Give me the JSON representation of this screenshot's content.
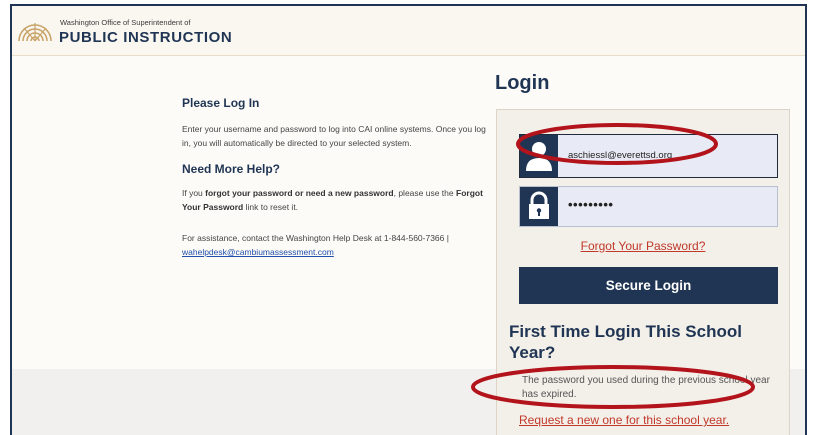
{
  "header": {
    "org_line": "Washington Office of Superintendent of",
    "org_name": "PUBLIC INSTRUCTION"
  },
  "info": {
    "heading": "Please Log In",
    "intro": "Enter your username and password to log into CAI online systems. Once you log in, you will automatically be directed to your selected system.",
    "help_heading": "Need More Help?",
    "help_pre": "If you ",
    "help_bold1": "forgot your password or need a new password",
    "help_mid": ", please use the ",
    "help_bold2": "Forgot Your Password",
    "help_post": " link to reset it.",
    "assist": "For assistance, contact the Washington Help Desk at 1-844-560-7366 | ",
    "assist_email": "wahelpdesk@cambiumassessment.com"
  },
  "login": {
    "title": "Login",
    "username_value": "aschiessl@everettsd.org",
    "password_value": "•••••••••",
    "forgot_link": "Forgot Your Password?",
    "submit_label": "Secure Login",
    "first_time_title": "First Time Login This School Year?",
    "expired_text": "The password you used during the previous school year has expired.",
    "request_link": "Request a new one for this school year."
  },
  "icons": {
    "logo": "ospi-sunburst-logo",
    "user": "user-icon",
    "lock": "lock-icon"
  },
  "colors": {
    "navy": "#1f3553",
    "link_red": "#c0392b",
    "annotation_red": "#b3131a"
  }
}
